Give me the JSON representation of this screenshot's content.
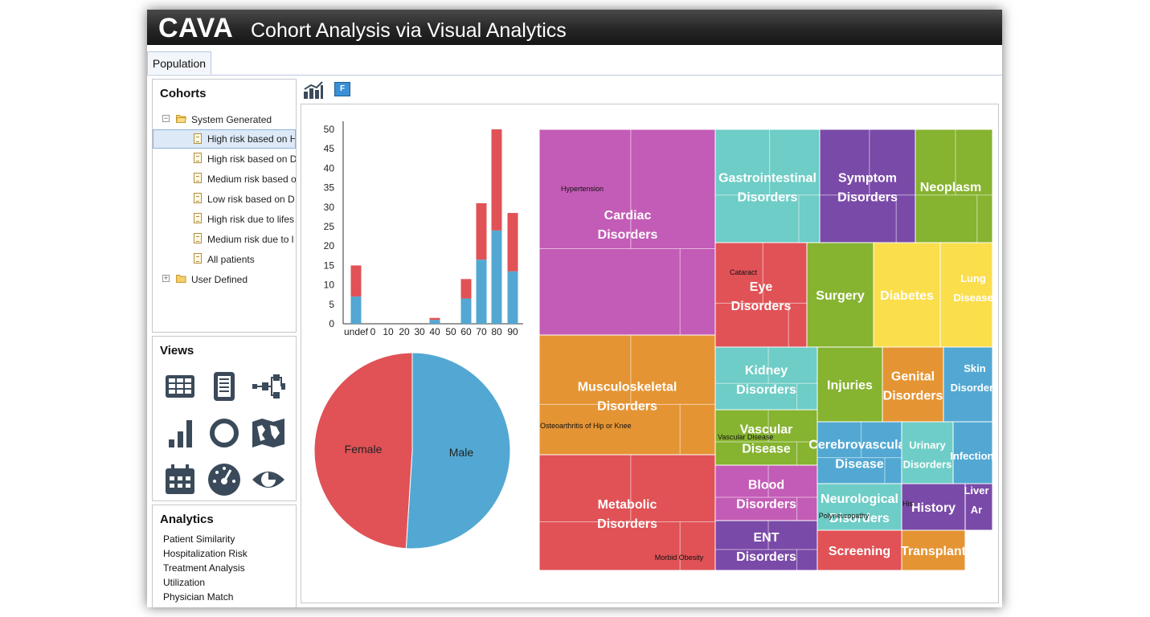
{
  "app": {
    "brand": "CAVA",
    "title": "Cohort Analysis via Visual Analytics",
    "tab": "Population"
  },
  "cohorts": {
    "title": "Cohorts",
    "items": [
      {
        "label": "System Generated",
        "type": "folder",
        "expanded": true
      },
      {
        "label": "High risk based on H",
        "type": "cohort",
        "selected": true
      },
      {
        "label": "High risk based on D",
        "type": "cohort"
      },
      {
        "label": "Medium risk based o",
        "type": "cohort"
      },
      {
        "label": "Low risk based on D",
        "type": "cohort"
      },
      {
        "label": "High risk due to lifes",
        "type": "cohort"
      },
      {
        "label": "Medium risk due to l",
        "type": "cohort"
      },
      {
        "label": "All patients",
        "type": "cohort"
      },
      {
        "label": "User Defined",
        "type": "folder",
        "expanded": false
      }
    ]
  },
  "views": {
    "title": "Views",
    "icons": [
      "table-icon",
      "document-list-icon",
      "flow-diagram-icon",
      "bar-chart-icon",
      "ring-icon",
      "map-icon",
      "calendar-icon",
      "gauge-icon",
      "eye-icon"
    ]
  },
  "analytics": {
    "title": "Analytics",
    "items": [
      "Patient Similarity",
      "Hospitalization Risk",
      "Treatment Analysis",
      "Utilization",
      "Physician Match"
    ]
  },
  "toolbar": {
    "filter_label": "F"
  },
  "colors": {
    "red": "#e05256",
    "blue": "#52a8d2",
    "purple": "#c35cb6",
    "teal": "#6ecdc6",
    "violet": "#7a4aa8",
    "green": "#86b330",
    "orange": "#e59434",
    "yellow": "#fbde4c"
  },
  "chart_data": [
    {
      "type": "bar",
      "stacked": true,
      "categories": [
        "undef",
        "0",
        "10",
        "20",
        "30",
        "40",
        "50",
        "60",
        "70",
        "80",
        "90"
      ],
      "series": [
        {
          "values": [
            7,
            0,
            0,
            0,
            0,
            1,
            0,
            6.5,
            16.5,
            24,
            13.5
          ]
        },
        {
          "values": [
            8,
            0,
            0,
            0,
            0,
            0.5,
            0,
            5,
            14.5,
            26,
            15
          ]
        }
      ],
      "ylim": [
        0,
        50
      ],
      "yticks": [
        "0",
        "5",
        "10",
        "15",
        "20",
        "25",
        "30",
        "35",
        "40",
        "45",
        "50"
      ]
    },
    {
      "type": "pie",
      "labels": [
        "Male",
        "Female"
      ],
      "values": [
        51,
        49
      ]
    },
    {
      "type": "treemap",
      "groups": [
        {
          "label": "Cardiac Disorders",
          "sublabel": "Hypertension",
          "color": "purple"
        },
        {
          "label": "Gastrointestinal Disorders",
          "color": "teal"
        },
        {
          "label": "Symptom Disorders",
          "color": "violet"
        },
        {
          "label": "Neoplasm",
          "color": "green"
        },
        {
          "label": "Eye Disorders",
          "sublabel": "Cataract",
          "color": "red"
        },
        {
          "label": "Surgery",
          "color": "green"
        },
        {
          "label": "Diabetes",
          "color": "yellow"
        },
        {
          "label": "Lung Disease",
          "color": "yellow"
        },
        {
          "label": "Musculoskeletal Disorders",
          "sublabel": "Osteoarthritis of Hip or Knee",
          "color": "orange"
        },
        {
          "label": "Kidney Disorders",
          "color": "teal"
        },
        {
          "label": "Injuries",
          "color": "green"
        },
        {
          "label": "Genital Disorders",
          "color": "orange"
        },
        {
          "label": "Skin Disorders",
          "color": "blue"
        },
        {
          "label": "Vascular Disease",
          "sublabel": "Vascular Disease",
          "color": "green"
        },
        {
          "label": "Cerebrovascular Disease",
          "color": "blue"
        },
        {
          "label": "Urinary Disorders",
          "color": "teal"
        },
        {
          "label": "Infections",
          "color": "blue"
        },
        {
          "label": "Metabolic Disorders",
          "sublabel": "Morbid Obesity",
          "color": "red"
        },
        {
          "label": "Blood Disorders",
          "color": "purple"
        },
        {
          "label": "Neurological Disorders",
          "sublabel": "Polyneuropathy",
          "color": "teal"
        },
        {
          "label": "History",
          "sublabel": "His",
          "color": "violet"
        },
        {
          "label": "Liver Ar",
          "color": "violet"
        },
        {
          "label": "ENT Disorders",
          "color": "violet"
        },
        {
          "label": "Screening",
          "color": "red"
        },
        {
          "label": "Transplant",
          "color": "orange"
        }
      ]
    }
  ]
}
